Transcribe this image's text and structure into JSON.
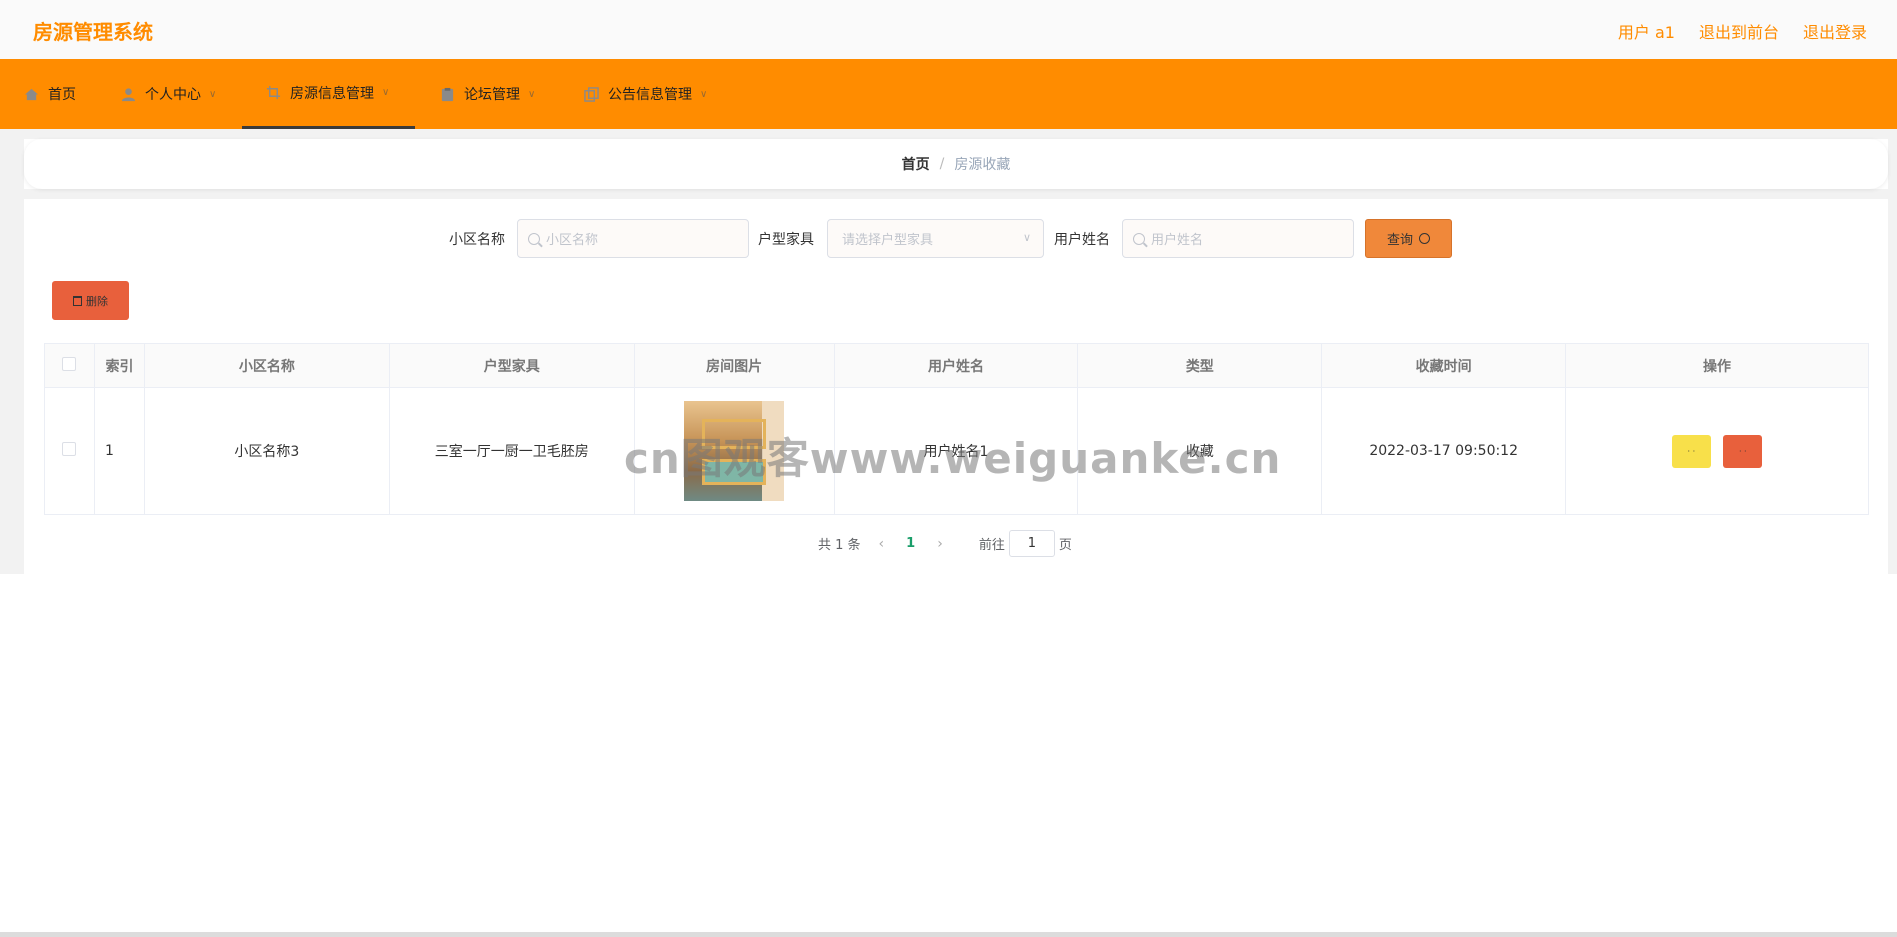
{
  "app": {
    "title": "房源管理系统"
  },
  "top_links": {
    "user": "用户 a1",
    "front": "退出到前台",
    "logout": "退出登录"
  },
  "nav": [
    {
      "label": "首页",
      "icon": "home-icon"
    },
    {
      "label": "个人中心",
      "icon": "user-icon"
    },
    {
      "label": "房源信息管理",
      "icon": "crop-icon"
    },
    {
      "label": "论坛管理",
      "icon": "clipboard-icon"
    },
    {
      "label": "公告信息管理",
      "icon": "copy-icon"
    }
  ],
  "breadcrumb": {
    "home": "首页",
    "sep": "/",
    "current": "房源收藏"
  },
  "search": {
    "community_label": "小区名称",
    "community_placeholder": "小区名称",
    "layout_label": "户型家具",
    "layout_placeholder": "请选择户型家具",
    "username_label": "用户姓名",
    "username_placeholder": "用户姓名",
    "query_button": "查询"
  },
  "actions": {
    "delete_button": "删除"
  },
  "table": {
    "headers": [
      "索引",
      "小区名称",
      "户型家具",
      "房间图片",
      "用户姓名",
      "类型",
      "收藏时间",
      "操作"
    ],
    "rows": [
      {
        "index": "1",
        "community": "小区名称3",
        "layout": "三室一厅一厨一卫毛胚房",
        "username": "用户姓名1",
        "type": "收藏",
        "time": "2022-03-17 09:50:12"
      }
    ]
  },
  "pagination": {
    "total": "共 1 条",
    "current": "1",
    "goto_prefix": "前往",
    "goto_value": "1",
    "goto_suffix": "页"
  },
  "watermark": "cn图观客www.weiguanke.cn",
  "colors": {
    "brand": "#ff8c00",
    "query": "#f0883a",
    "danger": "#e8603c",
    "warning": "#f8e04a",
    "active_page": "#1a9e6a"
  }
}
